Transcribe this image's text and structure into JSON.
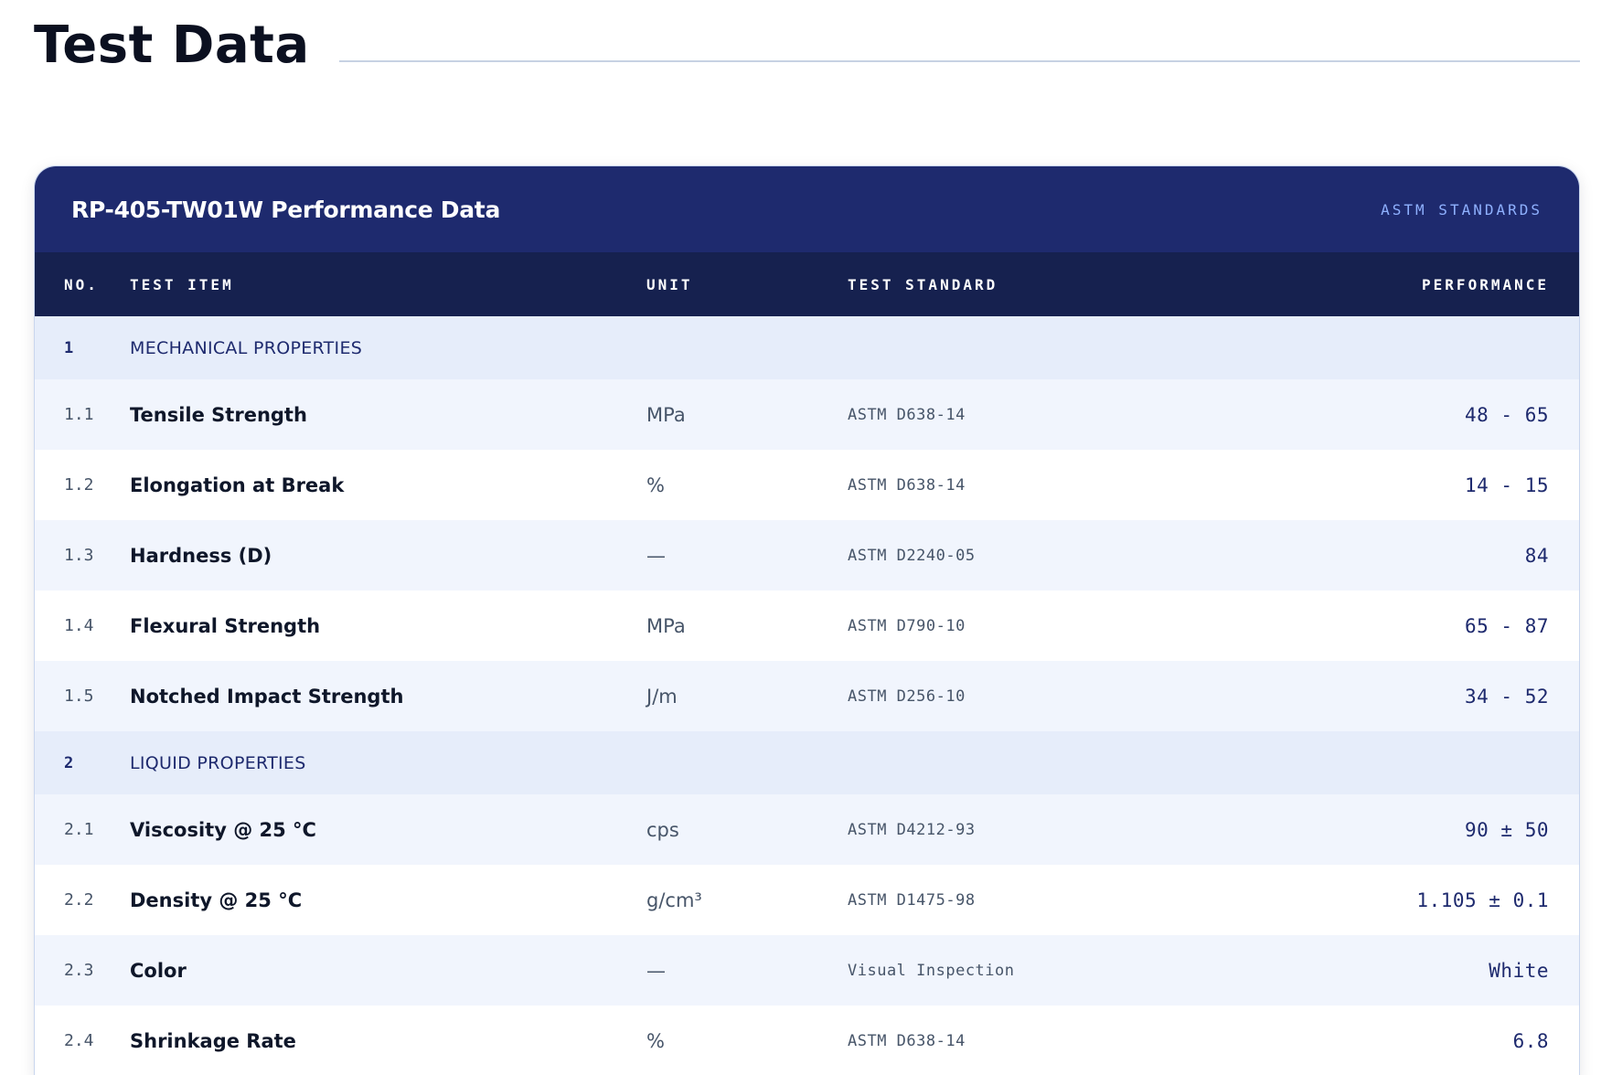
{
  "page": {
    "title": "Test Data"
  },
  "card": {
    "title": "RP-405-TW01W Performance Data",
    "badge": "ASTM STANDARDS"
  },
  "columns": {
    "no": "NO.",
    "item": "TEST ITEM",
    "unit": "UNIT",
    "standard": "TEST STANDARD",
    "performance": "PERFORMANCE"
  },
  "sections": [
    {
      "no": "1",
      "name": "MECHANICAL PROPERTIES",
      "rows": [
        {
          "no": "1.1",
          "item": "Tensile Strength",
          "unit": "MPa",
          "standard": "ASTM D638-14",
          "performance": "48 - 65"
        },
        {
          "no": "1.2",
          "item": "Elongation at Break",
          "unit": "%",
          "standard": "ASTM D638-14",
          "performance": "14 - 15"
        },
        {
          "no": "1.3",
          "item": "Hardness (D)",
          "unit": "—",
          "standard": "ASTM D2240-05",
          "performance": "84"
        },
        {
          "no": "1.4",
          "item": "Flexural Strength",
          "unit": "MPa",
          "standard": "ASTM D790-10",
          "performance": "65 - 87"
        },
        {
          "no": "1.5",
          "item": "Notched Impact Strength",
          "unit": "J/m",
          "standard": "ASTM D256-10",
          "performance": "34 - 52"
        }
      ]
    },
    {
      "no": "2",
      "name": "LIQUID PROPERTIES",
      "rows": [
        {
          "no": "2.1",
          "item": "Viscosity @ 25 °C",
          "unit": "cps",
          "standard": "ASTM D4212-93",
          "performance": "90 ± 50"
        },
        {
          "no": "2.2",
          "item": "Density @ 25 °C",
          "unit": "g/cm³",
          "standard": "ASTM D1475-98",
          "performance": "1.105 ± 0.1"
        },
        {
          "no": "2.3",
          "item": "Color",
          "unit": "—",
          "standard": "Visual Inspection",
          "performance": "White"
        },
        {
          "no": "2.4",
          "item": "Shrinkage Rate",
          "unit": "%",
          "standard": "ASTM D638-14",
          "performance": "6.8"
        }
      ]
    }
  ],
  "colors": {
    "card_header": "#1e2a6e",
    "column_header": "#16214f",
    "section_row": "#e6edfa",
    "alt_row": "#f1f5fd",
    "badge": "#8fb1ff"
  }
}
